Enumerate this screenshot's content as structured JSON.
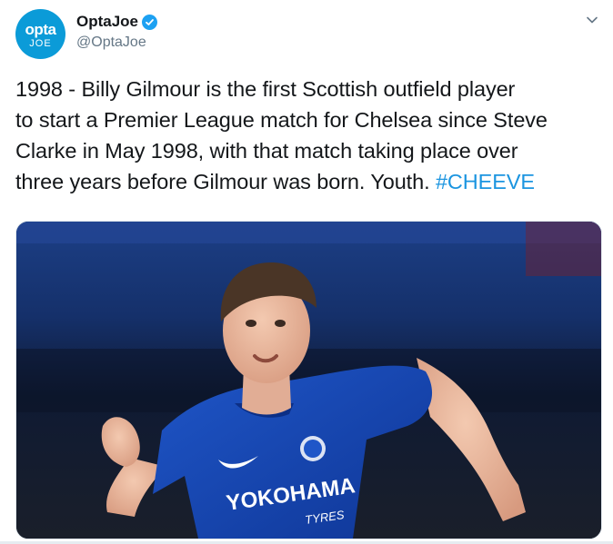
{
  "author": {
    "display_name": "OptaJoe",
    "handle": "@OptaJoe",
    "avatar_brand": "opta",
    "avatar_sub": "JOE",
    "verified": true,
    "avatar_color": "#0b9bd8"
  },
  "tweet": {
    "lines": [
      "1998 - Billy Gilmour is the first Scottish outfield player",
      "to start a Premier League match for Chelsea since Steve",
      "Clarke in May 1998, with that match taking place over",
      "three years before Gilmour was born. Youth. "
    ],
    "hashtag": "#CHEEVE",
    "hashtag_color": "#1b95e0"
  },
  "media": {
    "kit_sponsor_main": "YOKOHAMA",
    "kit_sponsor_sub": "TYRES"
  },
  "icons": {
    "menu": "chevron-down-icon",
    "verified": "verified-badge-icon"
  }
}
